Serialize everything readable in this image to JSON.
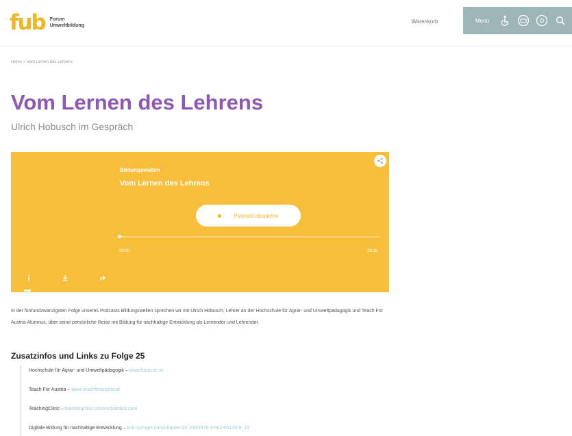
{
  "header": {
    "logo_mark": "fub",
    "logo_line1": "Forum",
    "logo_line2": "Umweltbildung",
    "link_label": "Warenkorb",
    "menu_label": "Menü",
    "icons": [
      "accessibility-icon",
      "easy-language-icon",
      "globe-icon",
      "search-icon"
    ],
    "bar_color": "#9fb6b9"
  },
  "breadcrumb": "Home > Vom Lernen des Lehrens",
  "page": {
    "title": "Vom Lernen des Lehrens",
    "subtitle": "Ulrich Hobusch im Gespräch",
    "title_color": "#8e57b3"
  },
  "player": {
    "podcast_name": "Bildungswellen",
    "episode_title": "Vom Lernen des Lehrens",
    "play_label": "Podcast abspielen",
    "time_start": "00:00",
    "time_end": "26:18",
    "background": "#f6be3b",
    "controls": [
      "info-icon",
      "download-icon",
      "share-icon"
    ]
  },
  "description": "In der fünfundzwanzigsten Folge unseres Podcasts Bildungswellen sprechen wir mit Ulrich Hobusch, Lehrer an der Hochschule für Agrar- und Umweltpädagogik und Teach For Austria Alumnus, über seine persönliche Reise mit Bildung für nachhaltige Entwicklung als Lernender und Lehrender.",
  "links": {
    "heading": "Zusatzinfos und Links zu Folge 25",
    "items": [
      {
        "label": "Hochschule für Agrar- und Umweltpädagogik – ",
        "url": "www.haup.ac.at"
      },
      {
        "label": "Teach For Austria – ",
        "url": "www.teachforaustria.at"
      },
      {
        "label": "TeachingClinic – ",
        "url": "teachingclinic.storiesthatstick.com"
      },
      {
        "label": "Digitale Bildung für nachhaltige Entwicklung – ",
        "url": "link.springer.com/chapter/10.1007/978-3-662-65120-9_15"
      }
    ]
  }
}
